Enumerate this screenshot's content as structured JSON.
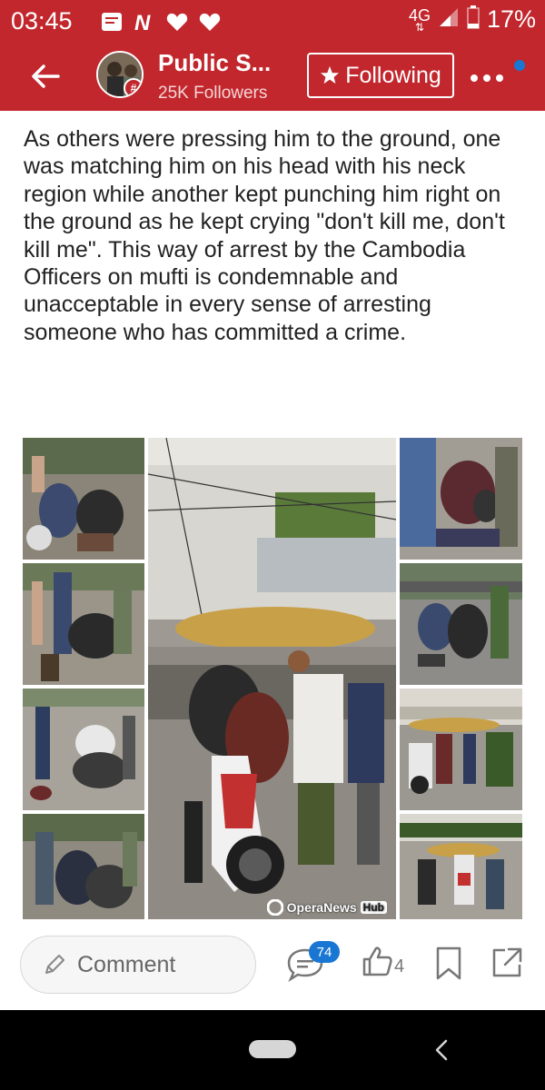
{
  "status_bar": {
    "time": "03:45",
    "network": "4G",
    "battery": "17%",
    "icons": [
      "message-icon",
      "news-n-icon",
      "heart-icon",
      "heart-icon",
      "signal-icon",
      "battery-icon"
    ]
  },
  "header": {
    "channel_name": "Public S...",
    "followers": "25K Followers",
    "follow_label": "Following",
    "avatar_badge": "#",
    "accent_color": "#c1272d"
  },
  "article": {
    "text": "As others were pressing him to the ground, one was matching him on his head with his neck region while another kept punching him right on the ground as he kept crying \"don't kill me, don't kill me\". This way of arrest by the Cambodia Officers on mufti is condemnable and unacceptable in every sense of arresting someone who has committed a crime."
  },
  "image": {
    "watermark_text": "OperaNews",
    "watermark_hub": "Hub"
  },
  "actions": {
    "comment_placeholder": "Comment",
    "comment_count": "74",
    "like_count": "4",
    "badge_color": "#1976d2"
  }
}
